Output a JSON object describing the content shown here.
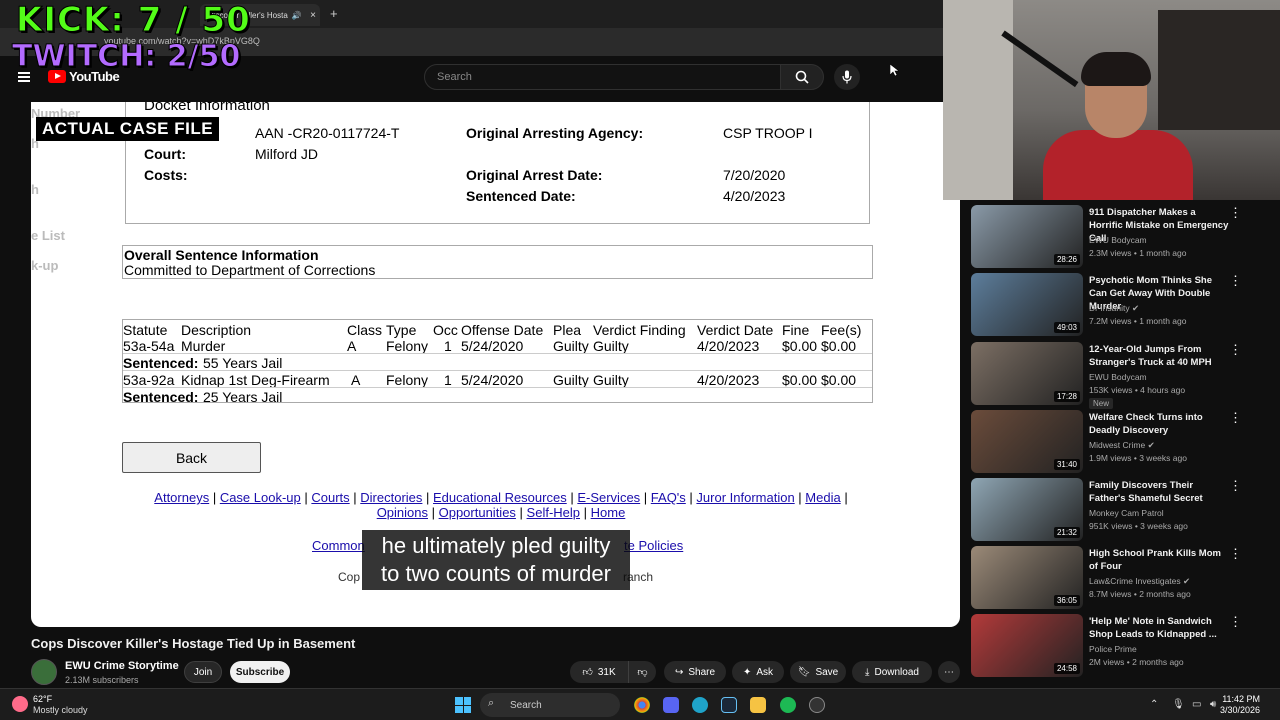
{
  "browser": {
    "tab_title": "Discover Killer's Hosta",
    "url": "youtube.com/watch?v=whD7kBpVG8Q"
  },
  "overlay": {
    "kick": "KICK: 7 / 50",
    "twitch": "TWITCH: 2/50",
    "case_label": "ACTUAL CASE FILE"
  },
  "youtube": {
    "logo": "YouTube",
    "search_placeholder": "Search"
  },
  "video": {
    "ghost_left": [
      "Number",
      "h",
      "h",
      "e List",
      "k-up"
    ],
    "docket": {
      "title": "Docket Information",
      "docket_no": "AAN -CR20-0117724-T",
      "court_label": "Court:",
      "court": "Milford JD",
      "costs_label": "Costs:",
      "agency_label": "Original Arresting Agency:",
      "agency": "CSP TROOP I",
      "arrest_label": "Original Arrest Date:",
      "arrest_date": "7/20/2020",
      "sentenced_label": "Sentenced Date:",
      "sentenced_date": "4/20/2023"
    },
    "overall": {
      "heading": "Overall Sentence Information",
      "text": "Committed to Department of Corrections"
    },
    "charges": {
      "headers": [
        "Statute",
        "Description",
        "Class",
        "Type",
        "Occ",
        "Offense Date",
        "Plea",
        "Verdict Finding",
        "Verdict Date",
        "Fine",
        "Fee(s)"
      ],
      "rows": [
        {
          "statute": "53a-54a",
          "description": "Murder",
          "class": "A",
          "type": "Felony",
          "occ": "1",
          "offense_date": "5/24/2020",
          "plea": "Guilty",
          "verdict": "Guilty",
          "verdict_date": "4/20/2023",
          "fine": "$0.00",
          "fees": "$0.00",
          "sentenced_label": "Sentenced:",
          "sentence": "55 Years Jail"
        },
        {
          "statute": "53a-92a",
          "description": "Kidnap 1st Deg-Firearm",
          "class": "A",
          "type": "Felony",
          "occ": "1",
          "offense_date": "5/24/2020",
          "plea": "Guilty",
          "verdict": "Guilty",
          "verdict_date": "4/20/2023",
          "fine": "$0.00",
          "fees": "$0.00",
          "sentenced_label": "Sentenced:",
          "sentence": "25 Years Jail"
        }
      ]
    },
    "back_label": "Back",
    "links": [
      "Attorneys",
      "Case Look-up",
      "Courts",
      "Directories",
      "Educational Resources",
      "E-Services",
      "FAQ's",
      "Juror Information",
      "Media",
      "Opinions",
      "Opportunities",
      "Self-Help",
      "Home"
    ],
    "footer_left": "Common",
    "footer_right": "te Policies",
    "copy_left": "Cop",
    "copy_right": "ranch",
    "caption": [
      "he ultimately pled guilty",
      "to two counts of murder"
    ]
  },
  "below": {
    "title": "Cops Discover Killer's Hostage Tied Up in Basement",
    "channel": "EWU Crime Storytime",
    "subs": "2.13M subscribers",
    "join": "Join",
    "subscribe": "Subscribe",
    "likes": "31K",
    "share": "Share",
    "ask": "Ask",
    "save": "Save",
    "download": "Download"
  },
  "recommendations": [
    {
      "title": "911 Dispatcher Makes a Horrific Mistake on Emergency Call",
      "channel": "EWU Bodycam",
      "meta": "2.3M views • 1 month ago",
      "duration": "28:26",
      "color": "#8a9aa8",
      "verified": false,
      "new": ""
    },
    {
      "title": "Psychotic Mom Thinks She Can Get Away With Double Murder",
      "channel": "Dr Insanity",
      "meta": "7.2M views • 1 month ago",
      "duration": "49:03",
      "color": "#5d7e9c",
      "verified": true,
      "new": ""
    },
    {
      "title": "12-Year-Old Jumps From Stranger's Truck at 40 MPH",
      "channel": "EWU Bodycam",
      "meta": "153K views • 4 hours ago",
      "duration": "17:28",
      "color": "#7c6f64",
      "verified": false,
      "new": "New"
    },
    {
      "title": "Welfare Check Turns into Deadly Discovery",
      "channel": "Midwest Crime",
      "meta": "1.9M views • 3 weeks ago",
      "duration": "31:40",
      "color": "#6b4c3b",
      "verified": true,
      "new": ""
    },
    {
      "title": "Family Discovers Their Father's Shameful Secret",
      "channel": "Monkey Cam Patrol",
      "meta": "951K views • 3 weeks ago",
      "duration": "21:32",
      "color": "#8fa6b4",
      "verified": false,
      "new": ""
    },
    {
      "title": "High School Prank Kills Mom of Four",
      "channel": "Law&Crime Investigates",
      "meta": "8.7M views • 2 months ago",
      "duration": "36:05",
      "color": "#9b8a78",
      "verified": true,
      "new": ""
    },
    {
      "title": "'Help Me' Note in Sandwich Shop Leads to Kidnapped ...",
      "channel": "Police Prime",
      "meta": "2M views • 2 months ago",
      "duration": "24:58",
      "color": "#b33a3a",
      "verified": false,
      "new": ""
    }
  ],
  "taskbar": {
    "temp": "62°F",
    "weather": "Mostly cloudy",
    "search": "Search",
    "time": "11:42 PM",
    "date": "3/30/2026"
  },
  "colors": {
    "kick": "#53fc18",
    "twitch": "#b36bff",
    "yt_red": "#ff0000",
    "link": "#1a0dab"
  }
}
